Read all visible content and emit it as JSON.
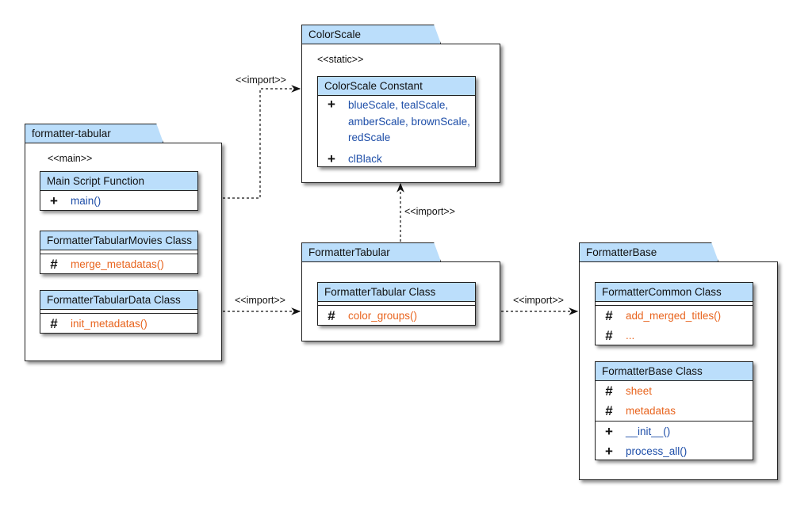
{
  "colors": {
    "header_fill": "#bbdefb",
    "public_member": "#1e4ea8",
    "protected_member": "#e8641e"
  },
  "packages": {
    "colorscale": {
      "name": "ColorScale",
      "stereotype": "<<static>>",
      "class": {
        "name": "ColorScale Constant",
        "members": [
          {
            "visibility": "+",
            "name": "blueScale, tealScale, amberScale, brownScale, redScale"
          },
          {
            "visibility": "+",
            "name": "clBlack"
          }
        ]
      }
    },
    "formatter_tabular_pkg": {
      "name": "formatter-tabular",
      "stereotype": "<<main>>",
      "classes": [
        {
          "name": "Main Script Function",
          "members": [
            {
              "visibility": "+",
              "name": "main()"
            }
          ]
        },
        {
          "name": "FormatterTabularMovies Class",
          "members": [
            {
              "visibility": "#",
              "name": "merge_metadatas()"
            }
          ]
        },
        {
          "name": "FormatterTabularData Class",
          "members": [
            {
              "visibility": "#",
              "name": "init_metadatas()"
            }
          ]
        }
      ]
    },
    "formattertabular": {
      "name": "FormatterTabular",
      "class": {
        "name": "FormatterTabular Class",
        "members": [
          {
            "visibility": "#",
            "name": "color_groups()"
          }
        ]
      }
    },
    "formatterbase": {
      "name": "FormatterBase",
      "classes": [
        {
          "name": "FormatterCommon Class",
          "members": [
            {
              "visibility": "#",
              "name": "add_merged_titles()"
            },
            {
              "visibility": "#",
              "name": "..."
            }
          ]
        },
        {
          "name": "FormatterBase Class",
          "attributes": [
            {
              "visibility": "#",
              "name": "sheet"
            },
            {
              "visibility": "#",
              "name": "metadatas"
            }
          ],
          "methods": [
            {
              "visibility": "+",
              "name": "__init__()"
            },
            {
              "visibility": "+",
              "name": "process_all()"
            }
          ]
        }
      ]
    }
  },
  "relations": [
    {
      "from": "formatter-tabular",
      "to": "ColorScale",
      "label": "<<import>>"
    },
    {
      "from": "formatter-tabular",
      "to": "FormatterTabular",
      "label": "<<import>>"
    },
    {
      "from": "FormatterTabular",
      "to": "ColorScale",
      "label": "<<import>>"
    },
    {
      "from": "FormatterTabular",
      "to": "FormatterBase",
      "label": "<<import>>"
    }
  ]
}
